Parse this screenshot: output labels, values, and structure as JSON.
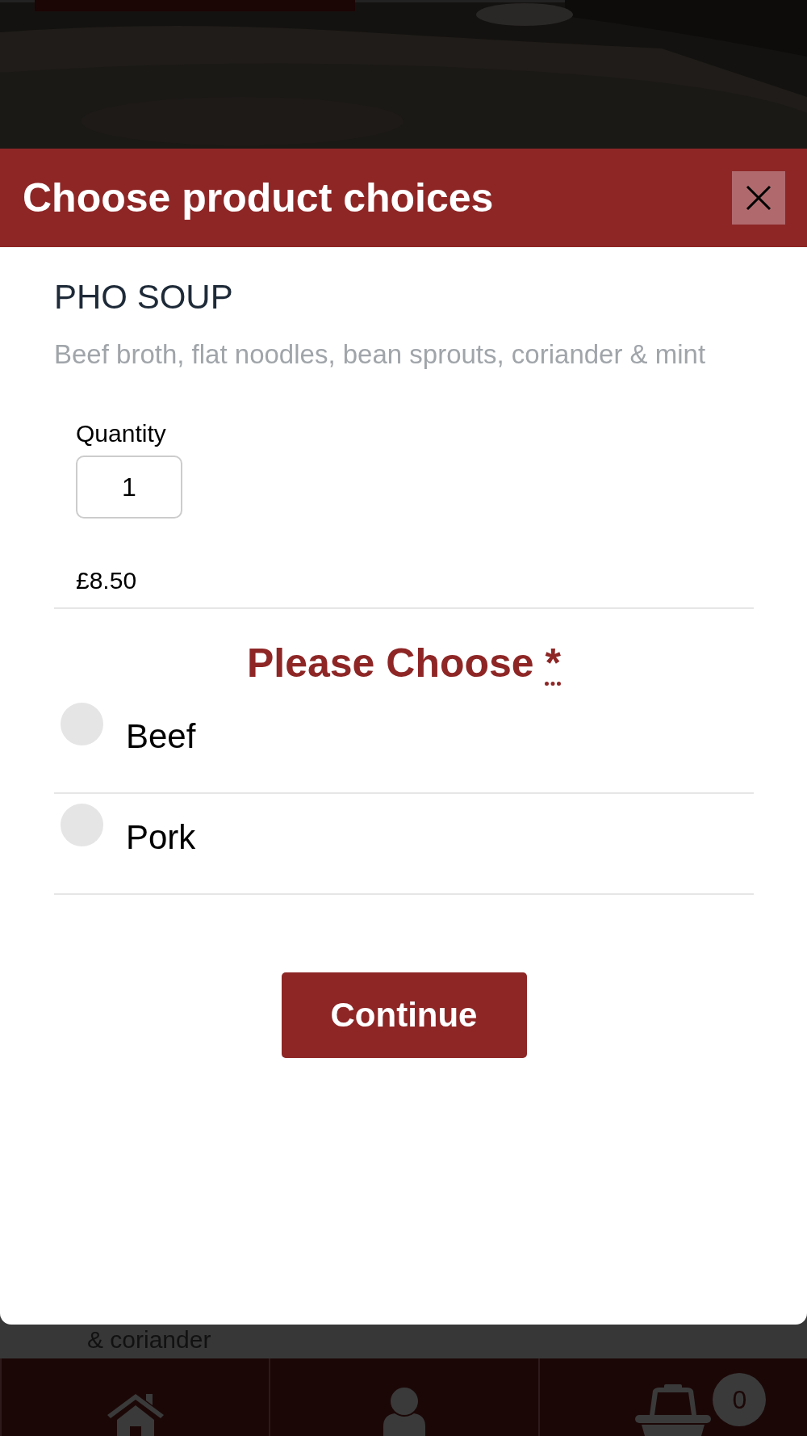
{
  "backdrop": {
    "kind": "picture",
    "text": "& coriander"
  },
  "modal": {
    "title": "Choose product choices",
    "product": {
      "name": "PHO SOUP",
      "description": "Beef broth, flat noodles, bean sprouts, coriander & mint"
    },
    "quantity": {
      "label": "Quantity",
      "value": "1"
    },
    "price": "£8.50",
    "choice": {
      "title": "Please Choose",
      "required_mark": "*",
      "options": [
        {
          "label": "Beef",
          "selected": false
        },
        {
          "label": "Pork",
          "selected": false
        }
      ]
    },
    "button": "Continue"
  },
  "nav": [
    {
      "kind": "home"
    },
    {
      "kind": "account"
    },
    {
      "kind": "cart",
      "badge": "0"
    }
  ]
}
